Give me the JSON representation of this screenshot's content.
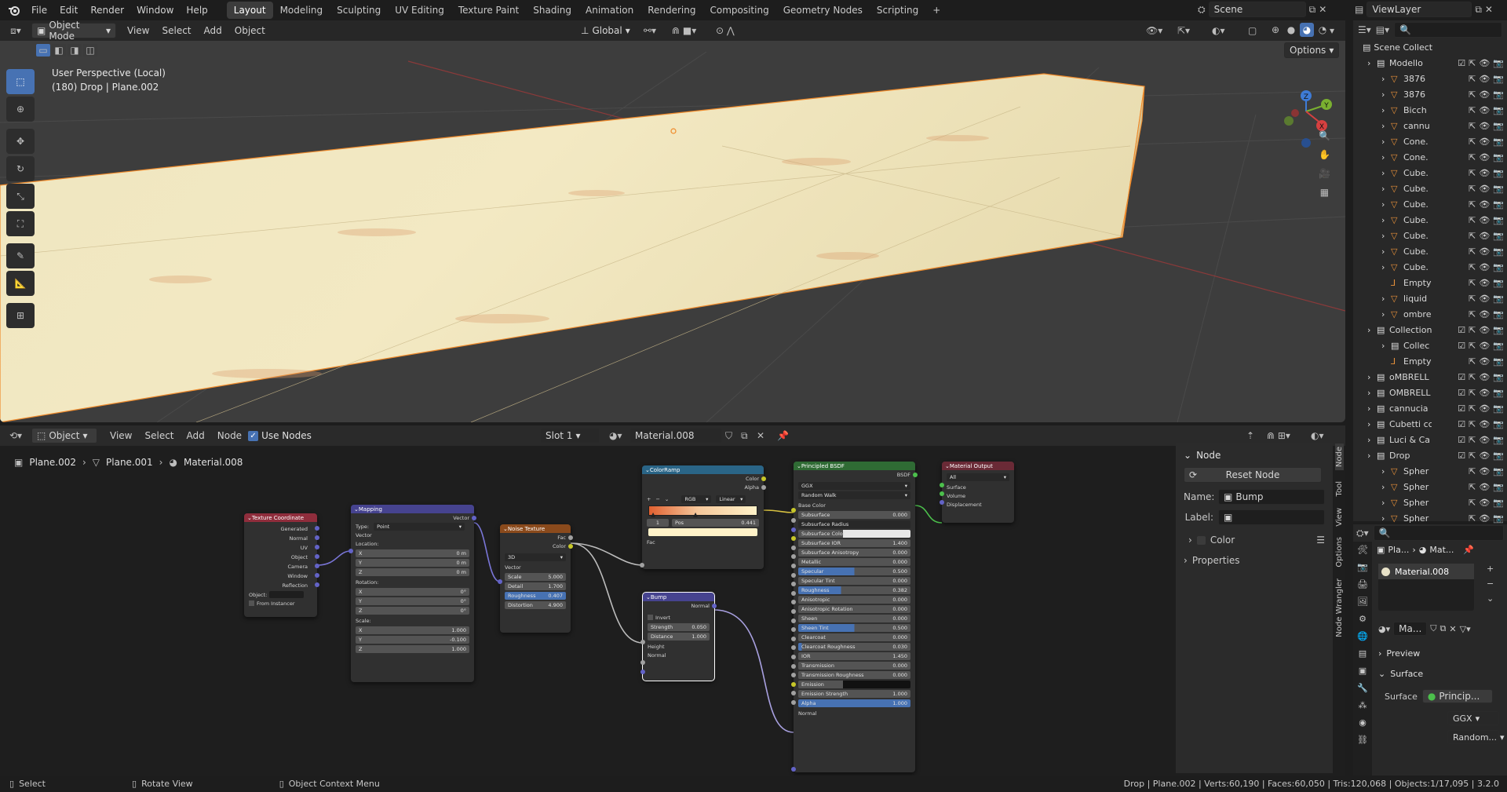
{
  "topbar": {
    "menus": [
      "File",
      "Edit",
      "Render",
      "Window",
      "Help"
    ],
    "workspaces": [
      "Layout",
      "Modeling",
      "Sculpting",
      "UV Editing",
      "Texture Paint",
      "Shading",
      "Animation",
      "Rendering",
      "Compositing",
      "Geometry Nodes",
      "Scripting"
    ],
    "active_workspace": "Layout",
    "scene": "Scene",
    "view_layer": "ViewLayer"
  },
  "viewport": {
    "mode": "Object Mode",
    "menus": [
      "View",
      "Select",
      "Add",
      "Object"
    ],
    "transform_orientation": "Global",
    "options_label": "Options",
    "overlay_line1": "User Perspective (Local)",
    "overlay_line2": "(180) Drop | Plane.002",
    "gizmo_labels": {
      "z": "Z",
      "y": "Y",
      "x": "X"
    }
  },
  "node_editor": {
    "type": "Object",
    "menus": [
      "View",
      "Select",
      "Add",
      "Node"
    ],
    "use_nodes_label": "Use Nodes",
    "slot": "Slot 1",
    "material": "Material.008",
    "breadcrumb": [
      "Plane.002",
      "Plane.001",
      "Material.008"
    ],
    "nodes": {
      "texcoord": {
        "title": "Texture Coordinate",
        "outputs": [
          "Generated",
          "Normal",
          "UV",
          "Object",
          "Camera",
          "Window",
          "Reflection"
        ],
        "object_label": "Object:",
        "from_instancer": "From Instancer"
      },
      "mapping": {
        "title": "Mapping",
        "vector_out": "Vector",
        "type_label": "Type:",
        "type_value": "Point",
        "vector_in": "Vector",
        "location": "Location:",
        "loc": [
          [
            "X",
            "0 m"
          ],
          [
            "Y",
            "0 m"
          ],
          [
            "Z",
            "0 m"
          ]
        ],
        "rotation": "Rotation:",
        "rot": [
          [
            "X",
            "0°"
          ],
          [
            "Y",
            "0°"
          ],
          [
            "Z",
            "0°"
          ]
        ],
        "scale": "Scale:",
        "scl": [
          [
            "X",
            "1.000"
          ],
          [
            "Y",
            "-0.100"
          ],
          [
            "Z",
            "1.000"
          ]
        ]
      },
      "noise": {
        "title": "Noise Texture",
        "fac": "Fac",
        "color": "Color",
        "dim": "3D",
        "vector": "Vector",
        "fields": [
          [
            "Scale",
            "5.000"
          ],
          [
            "Detail",
            "1.700"
          ],
          [
            "Roughness",
            "0.407"
          ],
          [
            "Distortion",
            "4.900"
          ]
        ]
      },
      "colorramp": {
        "title": "ColorRamp",
        "color": "Color",
        "alpha": "Alpha",
        "mode": "RGB",
        "interp": "Linear",
        "index": "1",
        "pos_label": "Pos",
        "pos": "0.441",
        "fac": "Fac",
        "plus": "+",
        "minus": "−"
      },
      "bump": {
        "title": "Bump",
        "normal_out": "Normal",
        "invert": "Invert",
        "strength_label": "Strength",
        "strength": "0.050",
        "distance_label": "Distance",
        "distance": "1.000",
        "height": "Height",
        "normal_in": "Normal"
      },
      "bsdf": {
        "title": "Principled BSDF",
        "out": "BSDF",
        "distribution": "GGX",
        "sss": "Random Walk",
        "base_color": "Base Color",
        "fields": [
          [
            "Subsurface",
            "0.000",
            0
          ],
          [
            "Subsurface Radius",
            "",
            0
          ],
          [
            "Subsurface Color",
            "",
            0
          ],
          [
            "Subsurface IOR",
            "1.400",
            0
          ],
          [
            "Subsurface Anisotropy",
            "0.000",
            0
          ],
          [
            "Metallic",
            "0.000",
            0
          ],
          [
            "Specular",
            "0.500",
            0.5
          ],
          [
            "Specular Tint",
            "0.000",
            0
          ],
          [
            "Roughness",
            "0.382",
            0.38
          ],
          [
            "Anisotropic",
            "0.000",
            0
          ],
          [
            "Anisotropic Rotation",
            "0.000",
            0
          ],
          [
            "Sheen",
            "0.000",
            0
          ],
          [
            "Sheen Tint",
            "0.500",
            0.5
          ],
          [
            "Clearcoat",
            "0.000",
            0
          ],
          [
            "Clearcoat Roughness",
            "0.030",
            0.03
          ],
          [
            "IOR",
            "1.450",
            0
          ],
          [
            "Transmission",
            "0.000",
            0
          ],
          [
            "Transmission Roughness",
            "0.000",
            0
          ],
          [
            "Emission",
            "",
            0
          ],
          [
            "Emission Strength",
            "1.000",
            0
          ],
          [
            "Alpha",
            "1.000",
            1
          ]
        ],
        "normal": "Normal"
      },
      "output": {
        "title": "Material Output",
        "target": "All",
        "inputs": [
          "Surface",
          "Volume",
          "Displacement"
        ]
      }
    }
  },
  "npanel": {
    "section": "Node",
    "reset": "Reset Node",
    "name_label": "Name:",
    "name_value": "Bump",
    "label_label": "Label:",
    "color": "Color",
    "properties": "Properties",
    "tabs": [
      "Node",
      "Tool",
      "View",
      "Options",
      "Node Wrangler"
    ]
  },
  "outliner": {
    "root": "Scene Collect",
    "rows": [
      {
        "name": "Modello",
        "depth": 1,
        "kind": "coll"
      },
      {
        "name": "3876",
        "depth": 2,
        "kind": "mesh"
      },
      {
        "name": "3876",
        "depth": 2,
        "kind": "mesh"
      },
      {
        "name": "Bicch",
        "depth": 2,
        "kind": "mesh"
      },
      {
        "name": "cannu",
        "depth": 2,
        "kind": "mesh"
      },
      {
        "name": "Cone.",
        "depth": 2,
        "kind": "mesh"
      },
      {
        "name": "Cone.",
        "depth": 2,
        "kind": "mesh"
      },
      {
        "name": "Cube.",
        "depth": 2,
        "kind": "mesh"
      },
      {
        "name": "Cube.",
        "depth": 2,
        "kind": "mesh"
      },
      {
        "name": "Cube.",
        "depth": 2,
        "kind": "mesh"
      },
      {
        "name": "Cube.",
        "depth": 2,
        "kind": "mesh"
      },
      {
        "name": "Cube.",
        "depth": 2,
        "kind": "mesh"
      },
      {
        "name": "Cube.",
        "depth": 2,
        "kind": "mesh"
      },
      {
        "name": "Cube.",
        "depth": 2,
        "kind": "mesh"
      },
      {
        "name": "Empty",
        "depth": 2,
        "kind": "empty"
      },
      {
        "name": "liquid",
        "depth": 2,
        "kind": "mesh"
      },
      {
        "name": "ombre",
        "depth": 2,
        "kind": "mesh"
      },
      {
        "name": "Collection",
        "depth": 1,
        "kind": "coll"
      },
      {
        "name": "Collec",
        "depth": 2,
        "kind": "coll"
      },
      {
        "name": "Empty",
        "depth": 2,
        "kind": "empty"
      },
      {
        "name": "oMBRELL",
        "depth": 1,
        "kind": "coll"
      },
      {
        "name": "OMBRELL",
        "depth": 1,
        "kind": "coll"
      },
      {
        "name": "cannucia",
        "depth": 1,
        "kind": "coll"
      },
      {
        "name": "Cubetti cc",
        "depth": 1,
        "kind": "coll"
      },
      {
        "name": "Luci & Ca",
        "depth": 1,
        "kind": "coll"
      },
      {
        "name": "Drop",
        "depth": 1,
        "kind": "coll"
      },
      {
        "name": "Spher",
        "depth": 2,
        "kind": "mesh"
      },
      {
        "name": "Spher",
        "depth": 2,
        "kind": "mesh"
      },
      {
        "name": "Spher",
        "depth": 2,
        "kind": "mesh"
      },
      {
        "name": "Spher",
        "depth": 2,
        "kind": "mesh"
      }
    ]
  },
  "properties": {
    "crumb_obj": "Pla...",
    "crumb_mat": "Mat...",
    "slot_material": "Material.008",
    "mat_short": "Ma...",
    "preview": "Preview",
    "surface": "Surface",
    "surface_label": "Surface",
    "surface_value": "Princip...",
    "distribution": "GGX",
    "sss": "Random..."
  },
  "status": {
    "select": "Select",
    "rotate": "Rotate View",
    "context": "Object Context Menu",
    "stats": "Drop | Plane.002 | Verts:60,190 | Faces:60,050 | Tris:120,068 | Objects:1/17,095 | 3.2.0"
  },
  "colors": {
    "accent": "#4772b3",
    "node_bsdf": "#2f6b34",
    "node_tex": "#8a4a1c",
    "node_vec": "#46438f",
    "node_input": "#8f2d3c",
    "node_conv": "#2a6587",
    "node_out": "#6a2a36"
  }
}
